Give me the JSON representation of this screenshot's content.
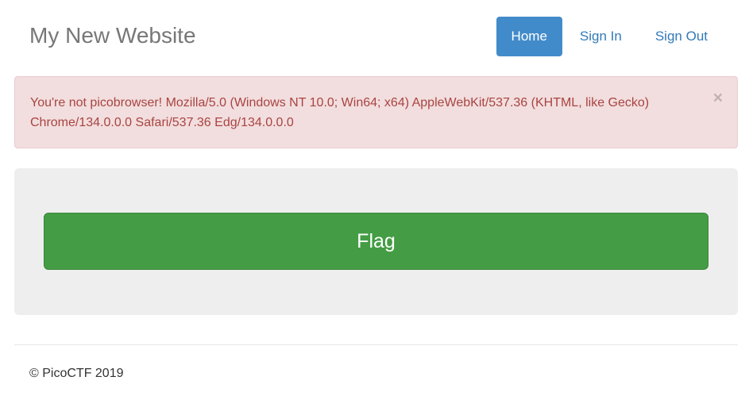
{
  "header": {
    "brand": "My New Website",
    "nav": {
      "home": "Home",
      "sign_in": "Sign In",
      "sign_out": "Sign Out"
    }
  },
  "alert": {
    "message": "You're not picobrowser! Mozilla/5.0 (Windows NT 10.0; Win64; x64) AppleWebKit/537.36 (KHTML, like Gecko) Chrome/134.0.0.0 Safari/537.36 Edg/134.0.0.0",
    "close": "×"
  },
  "main": {
    "flag_button": "Flag"
  },
  "footer": {
    "copyright": "© PicoCTF 2019"
  },
  "colors": {
    "primary": "#428bca",
    "link": "#337ab7",
    "danger_bg": "#f2dede",
    "danger_text": "#a94442",
    "success": "#449d44",
    "jumbotron": "#eeeeee"
  }
}
